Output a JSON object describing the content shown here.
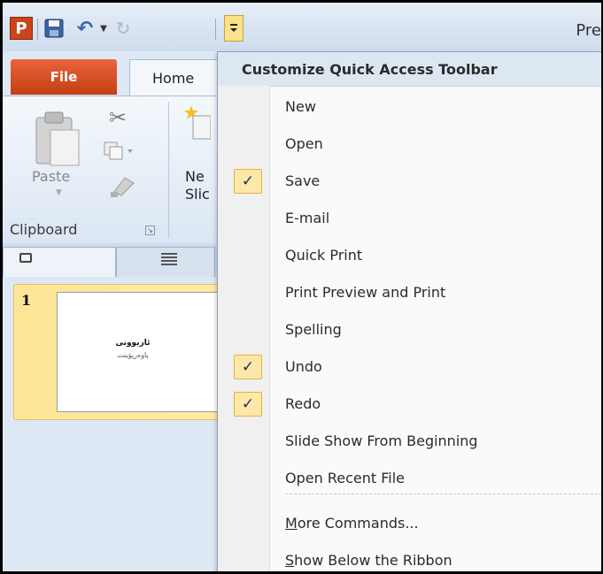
{
  "window": {
    "title_fragment": "Pre"
  },
  "qat": {
    "app_icon_letter": "P",
    "icons": [
      "powerpoint-app-icon",
      "save-icon",
      "undo-icon",
      "undo-dropdown-icon",
      "redo-icon",
      "customize-dropdown-icon"
    ]
  },
  "ribbon": {
    "tabs": {
      "file": "File",
      "home": "Home"
    },
    "clipboard": {
      "paste": "Paste",
      "group_label": "Clipboard"
    },
    "slides": {
      "new_slide_line1": "Ne",
      "new_slide_line2": "Slic"
    }
  },
  "pane": {
    "slide_number": "1",
    "slide_title": "ئازيوونى",
    "slide_subtitle": "پاوەرپۆينت"
  },
  "menu": {
    "header": "Customize Quick Access Toolbar",
    "items": [
      {
        "label": "New",
        "checked": false
      },
      {
        "label": "Open",
        "checked": false
      },
      {
        "label": "Save",
        "checked": true
      },
      {
        "label": "E-mail",
        "checked": false
      },
      {
        "label": "Quick Print",
        "checked": false
      },
      {
        "label": "Print Preview and Print",
        "checked": false
      },
      {
        "label": "Spelling",
        "checked": false
      },
      {
        "label": "Undo",
        "checked": true
      },
      {
        "label": "Redo",
        "checked": true
      },
      {
        "label": "Slide Show From Beginning",
        "checked": false
      },
      {
        "label": "Open Recent File",
        "checked": false
      }
    ],
    "more_commands": {
      "accel": "M",
      "rest": "ore Commands..."
    },
    "show_below": {
      "accel": "S",
      "rest": "how Below the Ribbon"
    },
    "check_glyph": "✓"
  },
  "colors": {
    "accent_file": "#c43f12",
    "check_bg": "#fde7a9",
    "selected_slide": "#fde597",
    "ribbon_bg": "#dde8f4"
  }
}
